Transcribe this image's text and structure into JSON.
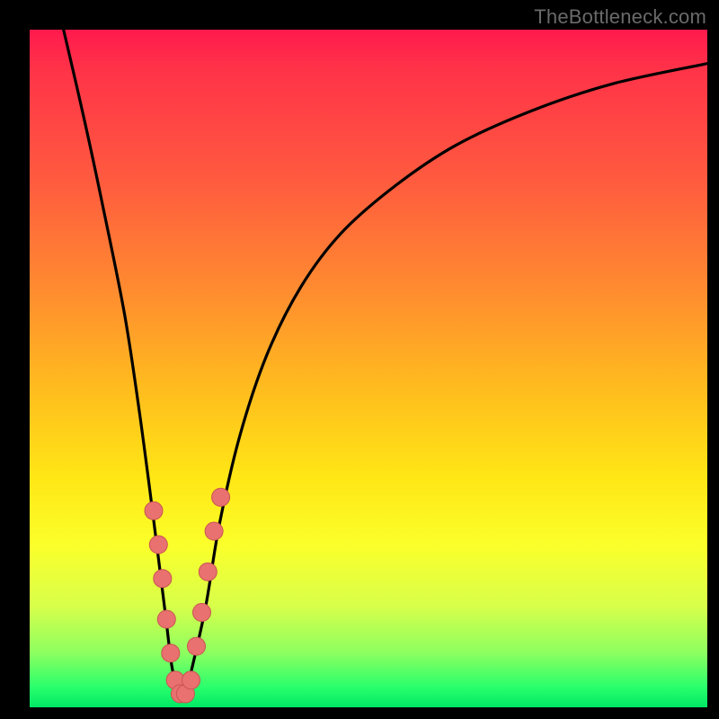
{
  "watermark": "TheBottleneck.com",
  "colors": {
    "frame": "#000000",
    "curve": "#000000",
    "dot_fill": "#e9716f",
    "dot_stroke": "#c95553",
    "gradient_top": "#ff1a4d",
    "gradient_bottom": "#00e865"
  },
  "chart_data": {
    "type": "line",
    "title": "",
    "xlabel": "",
    "ylabel": "",
    "xlim": [
      0,
      100
    ],
    "ylim": [
      0,
      100
    ],
    "grid": false,
    "legend": false,
    "series": [
      {
        "name": "bottleneck-curve",
        "note": "y ≈ 100 at edges, dips to ~2 near x≈22; values estimated from pixel positions",
        "x": [
          5,
          8,
          11,
          14,
          16,
          18,
          20,
          21,
          22,
          23,
          24,
          26,
          28,
          31,
          35,
          40,
          46,
          54,
          63,
          74,
          86,
          100
        ],
        "values": [
          100,
          87,
          73,
          58,
          45,
          30,
          14,
          6,
          2,
          2,
          6,
          15,
          27,
          40,
          52,
          62,
          70,
          77,
          83,
          88,
          92,
          95
        ]
      }
    ],
    "markers": {
      "name": "highlight-dots",
      "note": "pink beads clustered around the V-notch; (x,y) in same 0–100 space",
      "points": [
        [
          18.3,
          29
        ],
        [
          19.0,
          24
        ],
        [
          19.6,
          19
        ],
        [
          20.2,
          13
        ],
        [
          20.8,
          8
        ],
        [
          21.5,
          4
        ],
        [
          22.2,
          2
        ],
        [
          23.0,
          2
        ],
        [
          23.8,
          4
        ],
        [
          24.6,
          9
        ],
        [
          25.4,
          14
        ],
        [
          26.3,
          20
        ],
        [
          27.2,
          26
        ],
        [
          28.2,
          31
        ]
      ]
    }
  }
}
